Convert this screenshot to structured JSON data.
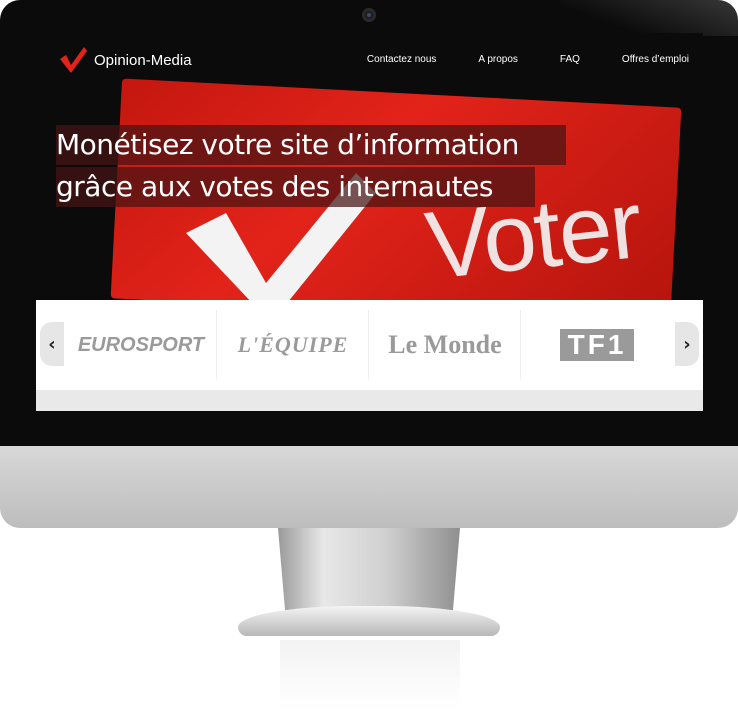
{
  "site": {
    "name": "Opinion-Media",
    "logo_icon": "checkmark-icon",
    "accent_color": "#e2231a"
  },
  "nav": {
    "links": [
      "Contactez nous",
      "A propos",
      "FAQ",
      "Offres d’emploi"
    ]
  },
  "hero": {
    "headline_line1": "Monétisez votre site d’information",
    "headline_line2": "grâce aux votes des internautes",
    "background_sign_text": "Voter"
  },
  "partners": {
    "items": [
      "EUROSPORT",
      "L'ÉQUIPE",
      "Le Monde",
      "TF1"
    ],
    "prev_icon": "chevron-left-icon",
    "next_icon": "chevron-right-icon"
  }
}
